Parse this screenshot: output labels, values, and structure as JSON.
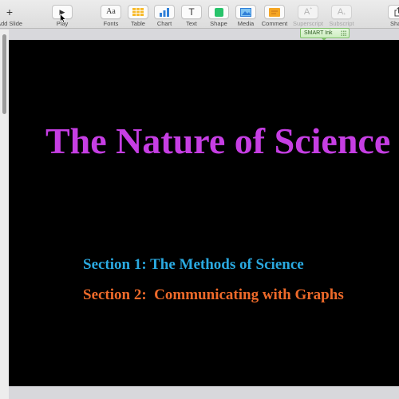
{
  "toolbar": {
    "items": [
      {
        "id": "add-slide",
        "label": "Add Slide",
        "icon": "plus-icon",
        "glyph": "+",
        "enabled": true
      },
      {
        "id": "play",
        "label": "Play",
        "icon": "play-icon",
        "glyph": "▶",
        "enabled": true
      },
      {
        "id": "fonts",
        "label": "Fonts",
        "icon": "fonts-icon",
        "glyph": "Aa",
        "enabled": true
      },
      {
        "id": "table",
        "label": "Table",
        "icon": "table-icon",
        "enabled": true
      },
      {
        "id": "chart",
        "label": "Chart",
        "icon": "chart-icon",
        "enabled": true
      },
      {
        "id": "text",
        "label": "Text",
        "icon": "text-icon",
        "glyph": "T",
        "enabled": true
      },
      {
        "id": "shape",
        "label": "Shape",
        "icon": "shape-icon",
        "enabled": true
      },
      {
        "id": "media",
        "label": "Media",
        "icon": "media-icon",
        "enabled": true
      },
      {
        "id": "comment",
        "label": "Comment",
        "icon": "comment-icon",
        "enabled": true
      },
      {
        "id": "superscript",
        "label": "Superscript",
        "icon": "superscript-icon",
        "glyph": "A",
        "enabled": false
      },
      {
        "id": "subscript",
        "label": "Subscript",
        "icon": "subscript-icon",
        "glyph": "A",
        "enabled": false
      },
      {
        "id": "share",
        "label": "Share",
        "icon": "share-icon",
        "enabled": true
      }
    ]
  },
  "smart_ink": {
    "label": "SMART Ink"
  },
  "slide": {
    "title": "The Nature of Science",
    "lines": [
      "Section 1: The Methods of Science",
      "Section 2:  Communicating with Graphs"
    ]
  },
  "colors": {
    "title": "#c63ee3",
    "line1": "#2aa9e0",
    "line2": "#ee6a2a",
    "slide_background": "#000000",
    "smart_ink_green": "#7fc06a"
  }
}
